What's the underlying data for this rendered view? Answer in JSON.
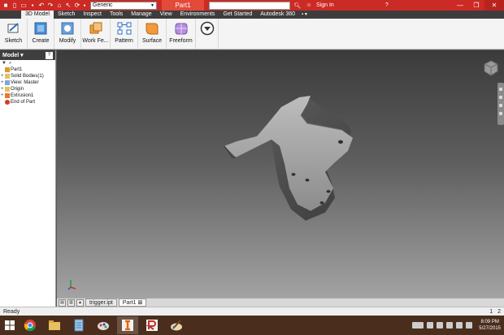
{
  "title_bar": {
    "appearance_value": "Generic",
    "document_title": "Part1",
    "sign_in": "Sign In",
    "accent": "#cc2a25"
  },
  "ribbon_tabs": [
    "3D Model",
    "Sketch",
    "Inspect",
    "Tools",
    "Manage",
    "View",
    "Environments",
    "Get Started",
    "Autodesk 360"
  ],
  "ribbon_buttons": [
    {
      "label": "Sketch",
      "icon": "sketch-icon"
    },
    {
      "label": "Create",
      "icon": "create-icon"
    },
    {
      "label": "Modify",
      "icon": "modify-icon"
    },
    {
      "label": "Work Fe...",
      "icon": "work-features-icon"
    },
    {
      "label": "Pattern",
      "icon": "pattern-icon"
    },
    {
      "label": "Surface",
      "icon": "surface-icon"
    },
    {
      "label": "Freeform",
      "icon": "freeform-icon"
    },
    {
      "label": "",
      "icon": "dropdown-circle-icon"
    }
  ],
  "browser": {
    "header": "Model",
    "help": "?",
    "tree": [
      {
        "label": "Part1",
        "expander": ""
      },
      {
        "label": "Solid Bodies(1)",
        "expander": "+"
      },
      {
        "label": "View: Master",
        "expander": "+"
      },
      {
        "label": "Origin",
        "expander": "+"
      },
      {
        "label": "Extrusion1",
        "expander": "+"
      },
      {
        "label": "End of Part",
        "expander": ""
      }
    ]
  },
  "document_tabs": [
    "trigger.ipt",
    "Part1"
  ],
  "status": {
    "text": "Ready",
    "numbers": [
      "1",
      "2"
    ]
  },
  "taskbar": {
    "apps": [
      "chrome-icon",
      "file-explorer-icon",
      "notepad-icon",
      "paint-icon",
      "inventor-icon",
      "revit-icon",
      "paint-brush-icon"
    ],
    "time": "8:09 PM",
    "date": "5/27/2015"
  }
}
